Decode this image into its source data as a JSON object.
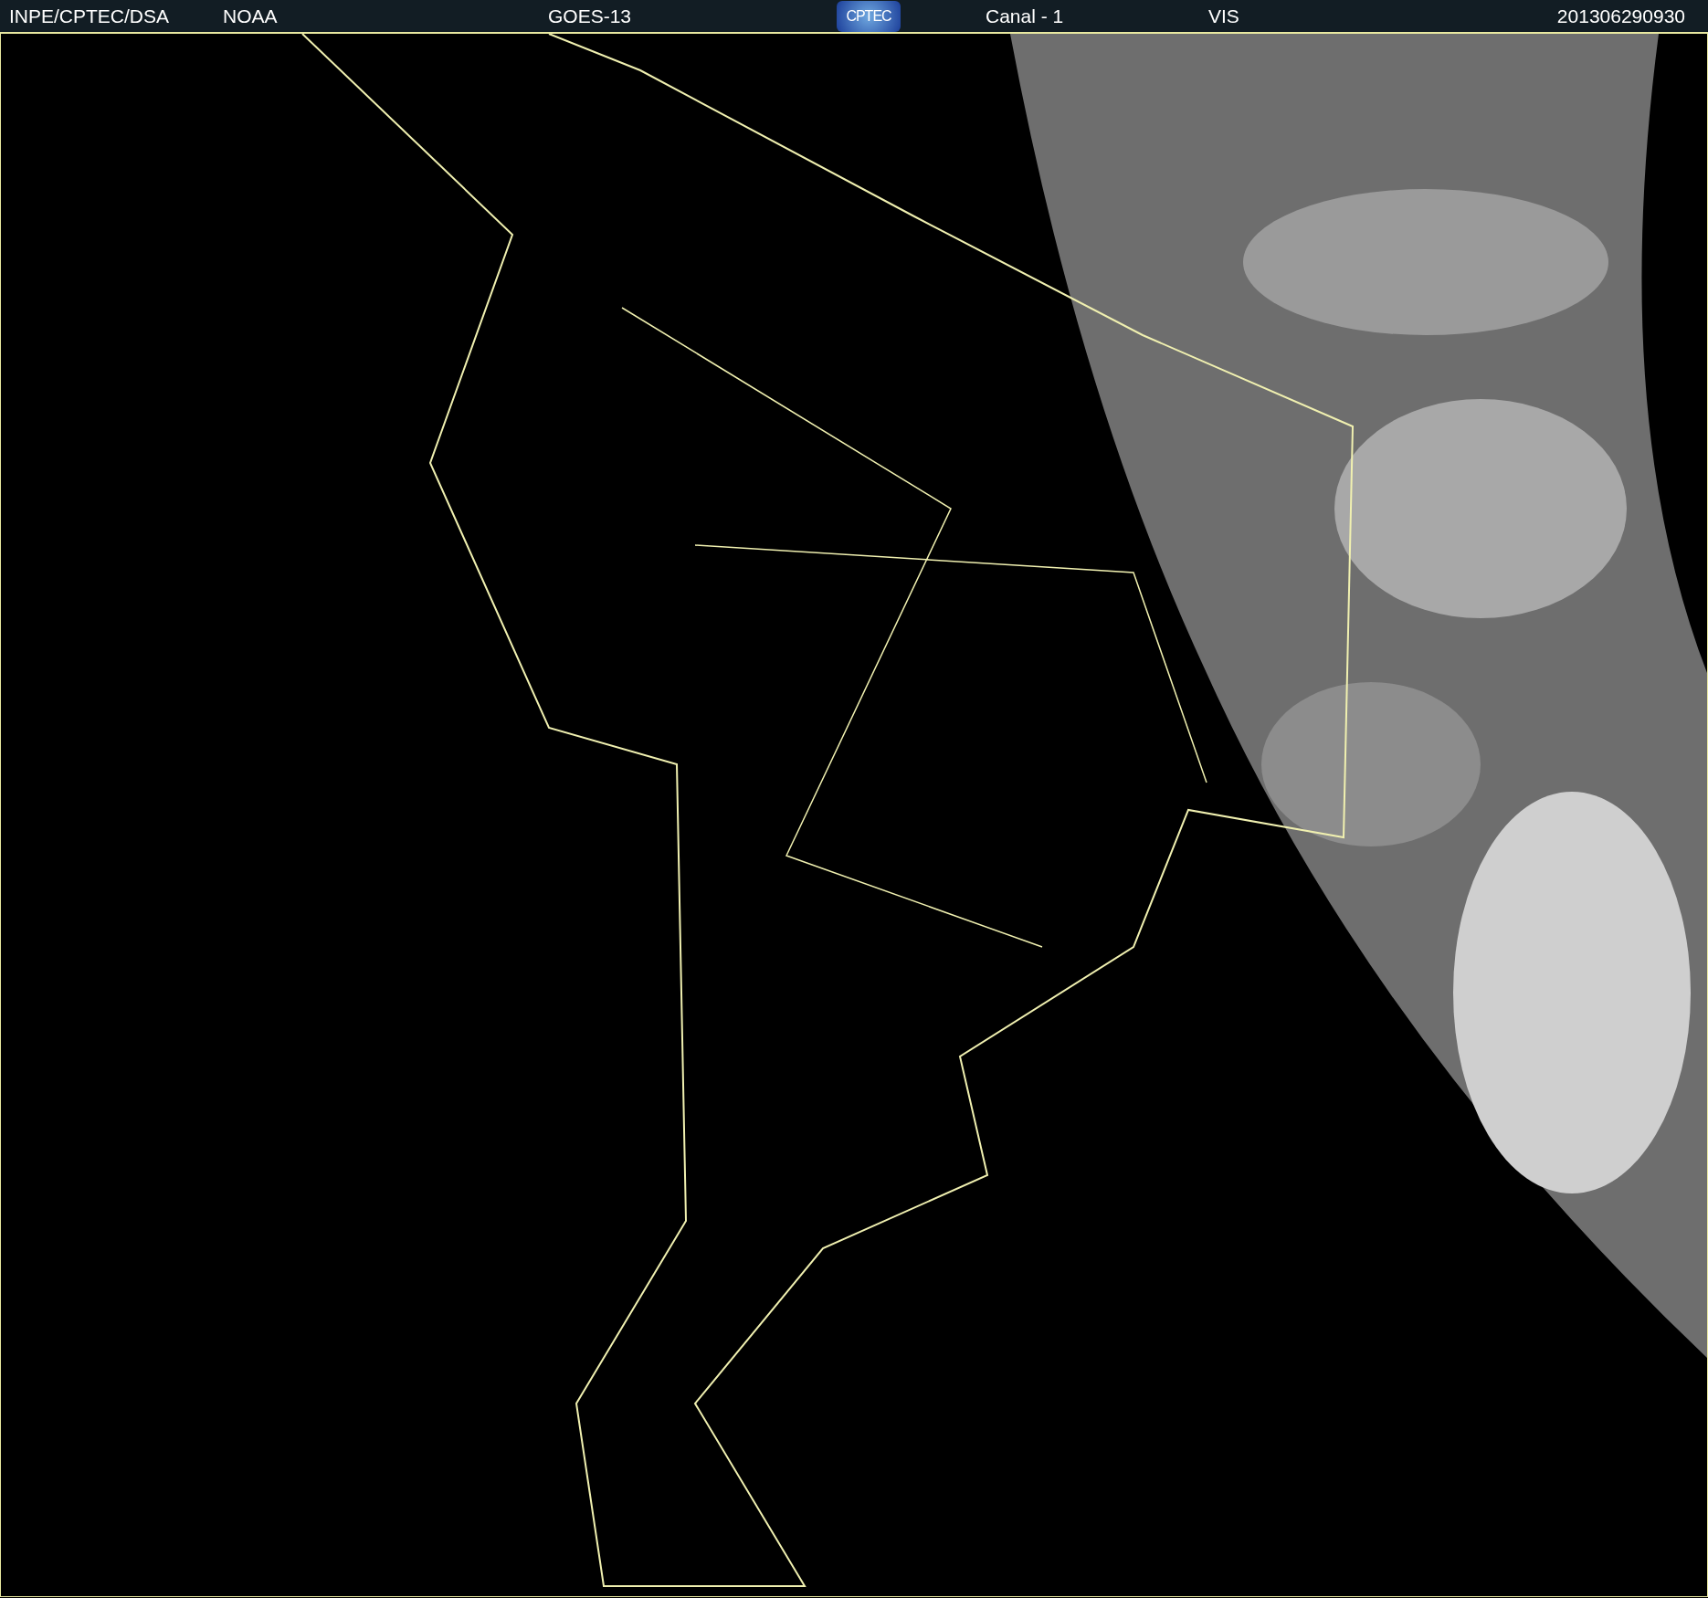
{
  "header": {
    "source": "INPE/CPTEC/DSA",
    "agency": "NOAA",
    "satellite": "GOES-13",
    "logo": "CPTEC",
    "channel": "Canal - 1",
    "band": "VIS",
    "timestamp": "201306290930"
  }
}
